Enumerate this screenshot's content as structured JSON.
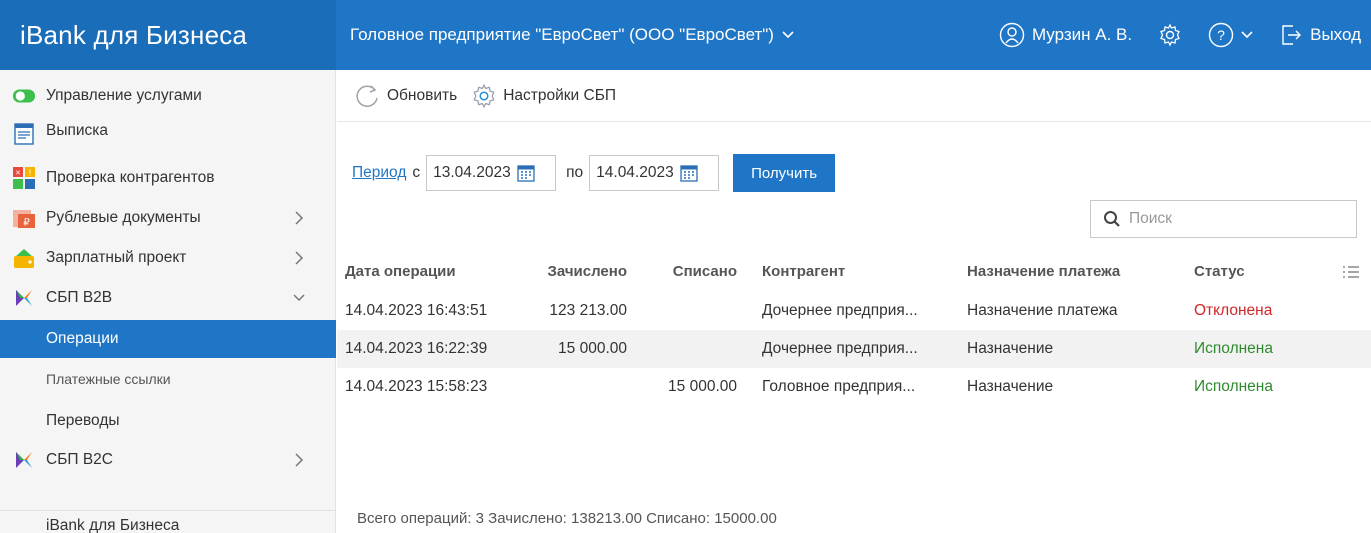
{
  "header": {
    "brand": "iBank для Бизнеса",
    "organization": "Головное предприятие \"ЕвроСвет\" (ООО \"ЕвроСвет\")",
    "user": "Мурзин А. В.",
    "logout": "Выход",
    "accent_color": "#1f76c7"
  },
  "sidebar": {
    "items": [
      {
        "label": "Управление услугами",
        "icon": "toggle-icon"
      },
      {
        "label": "Выписка",
        "icon": "statement-icon"
      },
      {
        "label": "Проверка контрагентов",
        "icon": "check-icon"
      },
      {
        "label": "Рублевые документы",
        "icon": "ruble-doc-icon"
      },
      {
        "label": "Зарплатный проект",
        "icon": "wallet-icon"
      },
      {
        "label": "СБП В2В",
        "icon": "sbp-icon"
      },
      {
        "label": "СБП В2С",
        "icon": "sbp-icon"
      }
    ],
    "sub_items": [
      {
        "label": "Операции"
      },
      {
        "label": "Платежные ссылки"
      },
      {
        "label": "Переводы"
      }
    ],
    "footer": "iBank для Бизнеса"
  },
  "toolbar": {
    "refresh": "Обновить",
    "sbp_settings": "Настройки СБП"
  },
  "filter": {
    "period_link": "Период",
    "from_label": "с",
    "from_date": "13.04.2023",
    "to_label": "по",
    "to_date": "14.04.2023",
    "get_button": "Получить"
  },
  "search": {
    "placeholder": "Поиск"
  },
  "table": {
    "columns": [
      "Дата операции",
      "Зачислено",
      "Списано",
      "Контрагент",
      "Назначение платежа",
      "Статус"
    ],
    "rows": [
      {
        "date": "14.04.2023 16:43:51",
        "credit": "123 213.00",
        "debit": "",
        "counterparty": "Дочернее предприя...",
        "purpose": "Назначение платежа",
        "status": "Отклонена"
      },
      {
        "date": "14.04.2023 16:22:39",
        "credit": "15 000.00",
        "debit": "",
        "counterparty": "Дочернее предприя...",
        "purpose": "Назначение",
        "status": "Исполнена"
      },
      {
        "date": "14.04.2023 15:58:23",
        "credit": "",
        "debit": "15 000.00",
        "counterparty": "Головное предприя...",
        "purpose": "Назначение",
        "status": "Исполнена"
      }
    ]
  },
  "summary": "Всего операций: 3 Зачислено: 138213.00 Списано: 15000.00",
  "status_colors": {
    "rejected": "#d0262a",
    "done": "#2f8a2f"
  }
}
